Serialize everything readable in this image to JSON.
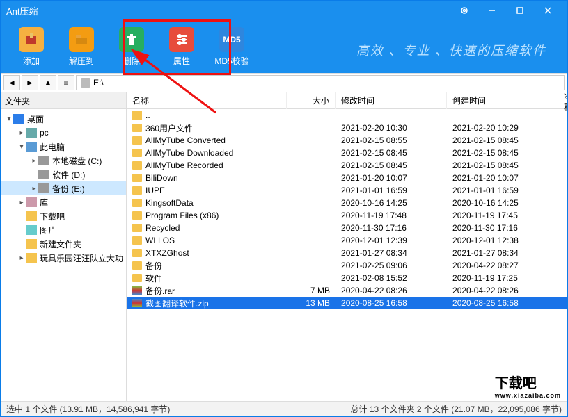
{
  "window": {
    "title": "Ant压缩"
  },
  "slogan": "高效 、专业 、快速的压缩软件",
  "toolbar": {
    "add": "添加",
    "extract": "解压到",
    "delete": "删除",
    "props": "属性",
    "md5": "MD5校验",
    "md5_badge": "MD5"
  },
  "addressbar": {
    "path": "E:\\"
  },
  "sidebar": {
    "header": "文件夹",
    "tree": [
      {
        "label": "桌面",
        "depth": 0,
        "icon": "desktop",
        "expanded": true
      },
      {
        "label": "pc",
        "depth": 1,
        "icon": "pc",
        "expanded": false
      },
      {
        "label": "此电脑",
        "depth": 1,
        "icon": "thispc",
        "expanded": true
      },
      {
        "label": "本地磁盘  (C:)",
        "depth": 2,
        "icon": "disk",
        "leaf": false
      },
      {
        "label": "软件  (D:)",
        "depth": 2,
        "icon": "disk",
        "leaf": true
      },
      {
        "label": "备份  (E:)",
        "depth": 2,
        "icon": "disk",
        "leaf": false,
        "selected": true
      },
      {
        "label": "库",
        "depth": 1,
        "icon": "lib",
        "leaf": false
      },
      {
        "label": "下载吧",
        "depth": 1,
        "icon": "dl",
        "leaf": true
      },
      {
        "label": "图片",
        "depth": 1,
        "icon": "pic",
        "leaf": true
      },
      {
        "label": "新建文件夹",
        "depth": 1,
        "icon": "fold",
        "leaf": true
      },
      {
        "label": "玩具乐园汪汪队立大功",
        "depth": 1,
        "icon": "fold",
        "leaf": false
      }
    ]
  },
  "columns": {
    "name": "名称",
    "size": "大小",
    "mtime": "修改时间",
    "ctime": "创建时间",
    "note": "注释"
  },
  "files": [
    {
      "name": "..",
      "type": "up",
      "size": "",
      "mtime": "",
      "ctime": ""
    },
    {
      "name": "360用户文件",
      "type": "folder",
      "size": "",
      "mtime": "2021-02-20 10:30",
      "ctime": "2021-02-20 10:29"
    },
    {
      "name": "AllMyTube Converted",
      "type": "folder",
      "size": "",
      "mtime": "2021-02-15 08:55",
      "ctime": "2021-02-15 08:45"
    },
    {
      "name": "AllMyTube Downloaded",
      "type": "folder",
      "size": "",
      "mtime": "2021-02-15 08:45",
      "ctime": "2021-02-15 08:45"
    },
    {
      "name": "AllMyTube Recorded",
      "type": "folder",
      "size": "",
      "mtime": "2021-02-15 08:45",
      "ctime": "2021-02-15 08:45"
    },
    {
      "name": "BiliDown",
      "type": "folder",
      "size": "",
      "mtime": "2021-01-20 10:07",
      "ctime": "2021-01-20 10:07"
    },
    {
      "name": "IUPE",
      "type": "folder",
      "size": "",
      "mtime": "2021-01-01 16:59",
      "ctime": "2021-01-01 16:59"
    },
    {
      "name": "KingsoftData",
      "type": "folder",
      "size": "",
      "mtime": "2020-10-16 14:25",
      "ctime": "2020-10-16 14:25"
    },
    {
      "name": "Program Files (x86)",
      "type": "folder",
      "size": "",
      "mtime": "2020-11-19 17:48",
      "ctime": "2020-11-19 17:45"
    },
    {
      "name": "Recycled",
      "type": "folder",
      "size": "",
      "mtime": "2020-11-30 17:16",
      "ctime": "2020-11-30 17:16"
    },
    {
      "name": "WLLOS",
      "type": "folder",
      "size": "",
      "mtime": "2020-12-01 12:39",
      "ctime": "2020-12-01 12:38"
    },
    {
      "name": "XTXZGhost",
      "type": "folder",
      "size": "",
      "mtime": "2021-01-27 08:34",
      "ctime": "2021-01-27 08:34"
    },
    {
      "name": "备份",
      "type": "folder",
      "size": "",
      "mtime": "2021-02-25 09:06",
      "ctime": "2020-04-22 08:27"
    },
    {
      "name": "软件",
      "type": "folder",
      "size": "",
      "mtime": "2021-02-08 15:52",
      "ctime": "2020-11-19 17:25"
    },
    {
      "name": "备份.rar",
      "type": "rar",
      "size": "7 MB",
      "mtime": "2020-04-22 08:26",
      "ctime": "2020-04-22 08:26"
    },
    {
      "name": "截图翻译软件.zip",
      "type": "zip",
      "size": "13 MB",
      "mtime": "2020-08-25 16:58",
      "ctime": "2020-08-25 16:58",
      "selected": true
    }
  ],
  "status": {
    "left": "选中 1 个文件  (13.91 MB，14,586,941 字节)",
    "right": "总计 13 个文件夹 2 个文件  (21.07 MB，22,095,086 字节)"
  },
  "watermark": {
    "main": "下载吧",
    "sub": "www.xiazaiba.com"
  }
}
